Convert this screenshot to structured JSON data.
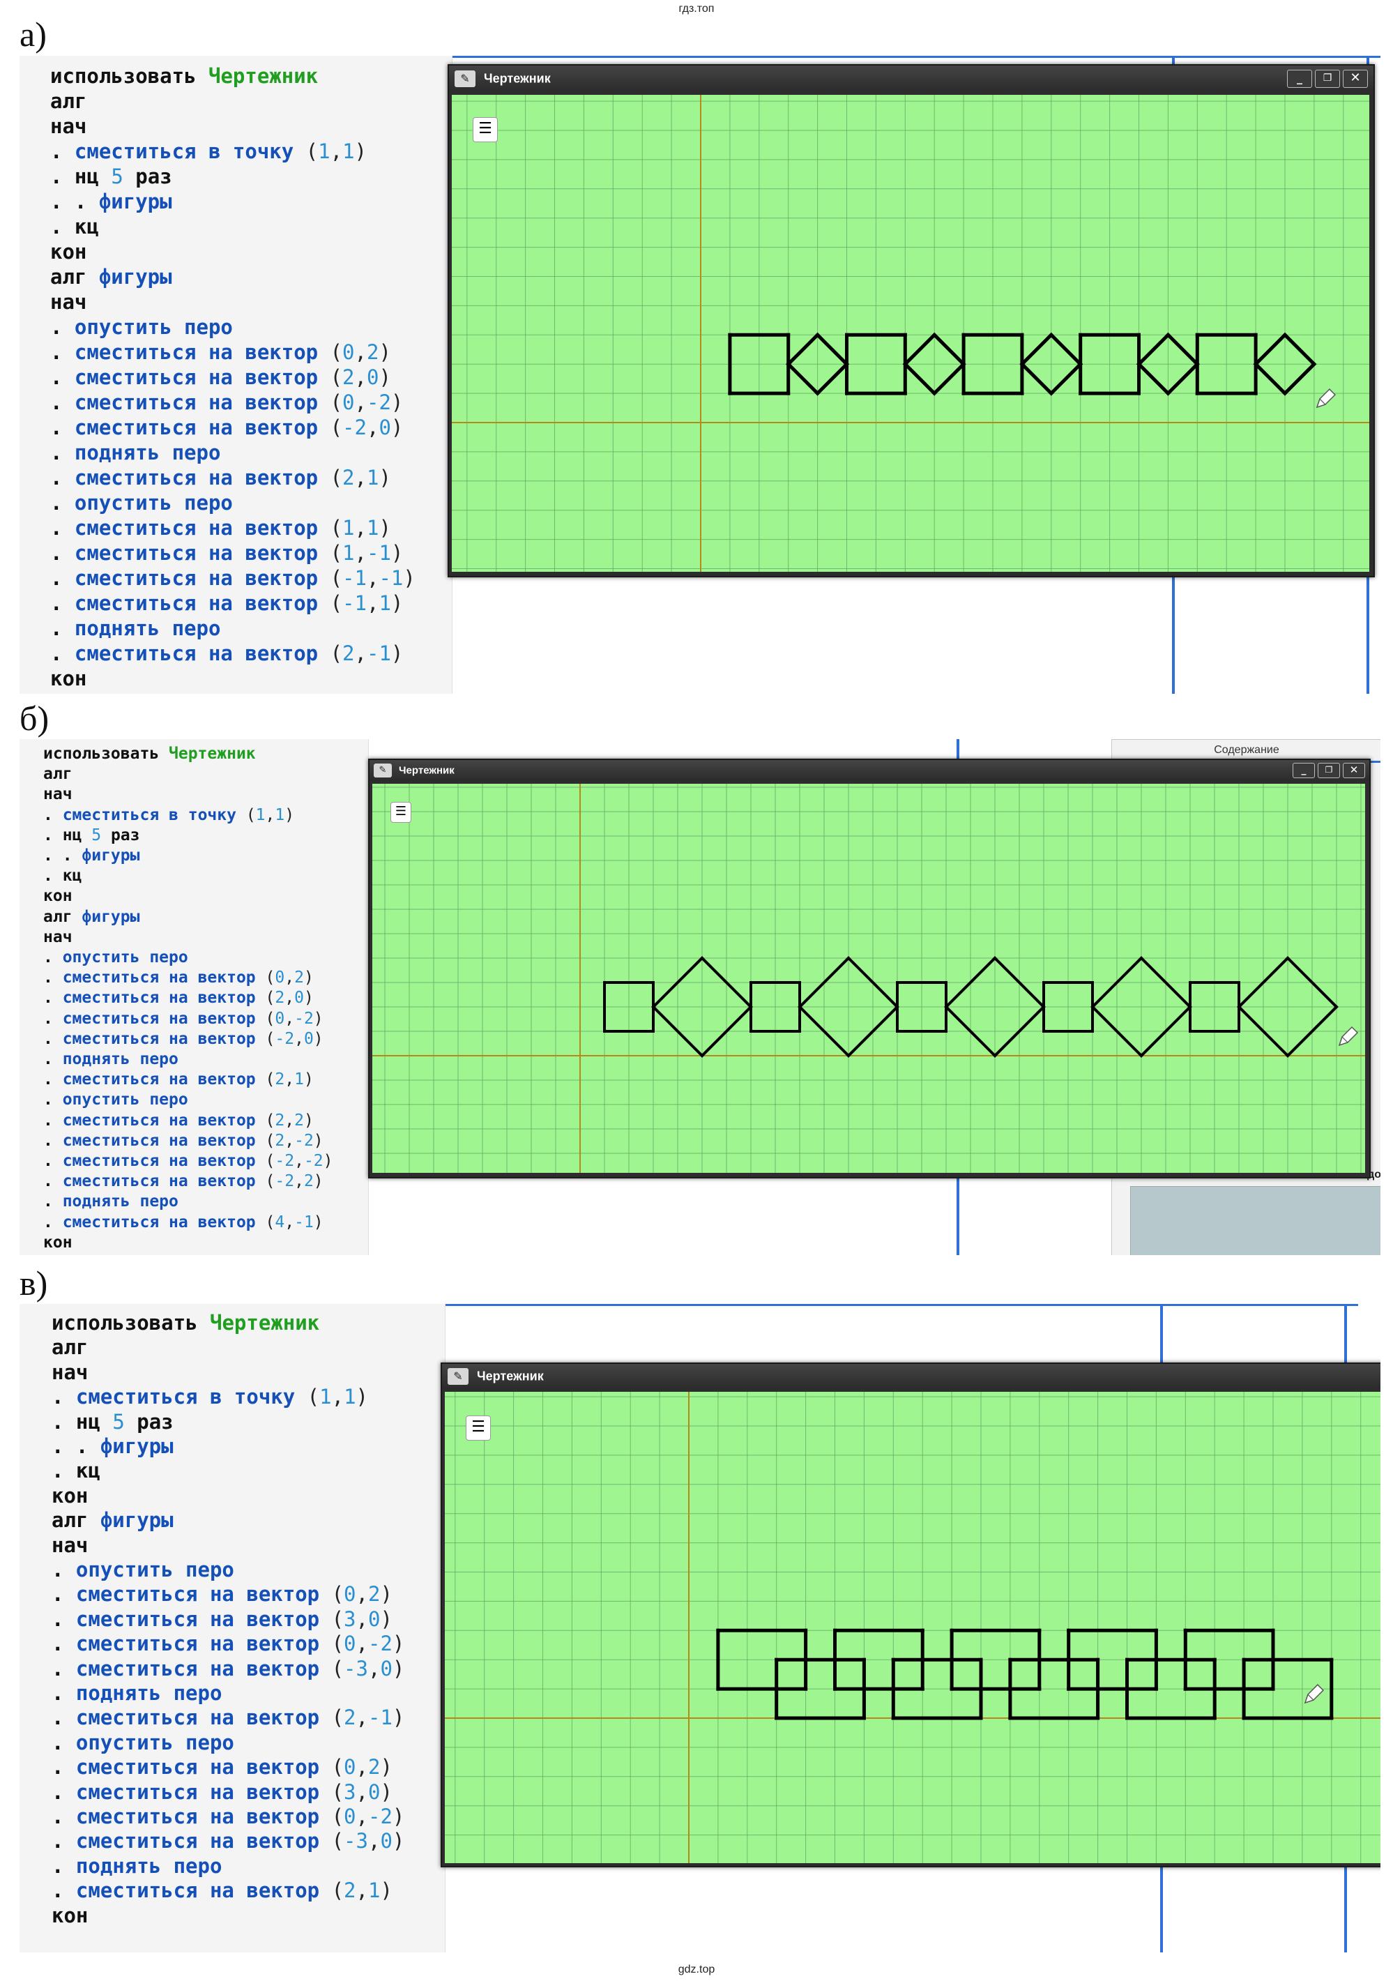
{
  "watermarks": {
    "top": "гдз.топ",
    "bottom": "gdz.top"
  },
  "panels": [
    {
      "label": "а)",
      "window_title": "Чертежник",
      "code": [
        [
          "использовать ",
          "Чертежник"
        ],
        [
          "алг"
        ],
        [
          "нач"
        ],
        [
          ". ",
          "сместиться в точку ",
          "(1,1)"
        ],
        [
          ". ",
          "нц ",
          "5",
          " раз"
        ],
        [
          ". . ",
          "фигуры"
        ],
        [
          ". ",
          "кц"
        ],
        [
          "кон"
        ],
        [
          "алг ",
          "фигуры"
        ],
        [
          "нач"
        ],
        [
          ". ",
          "опустить перо"
        ],
        [
          ". ",
          "сместиться на вектор ",
          "(0,2)"
        ],
        [
          ". ",
          "сместиться на вектор ",
          "(2,0)"
        ],
        [
          ". ",
          "сместиться на вектор ",
          "(0,-2)"
        ],
        [
          ". ",
          "сместиться на вектор ",
          "(-2,0)"
        ],
        [
          ". ",
          "поднять перо"
        ],
        [
          ". ",
          "сместиться на вектор ",
          "(2,1)"
        ],
        [
          ". ",
          "опустить перо"
        ],
        [
          ". ",
          "сместиться на вектор ",
          "(1,1)"
        ],
        [
          ". ",
          "сместиться на вектор ",
          "(1,-1)"
        ],
        [
          ". ",
          "сместиться на вектор ",
          "(-1,-1)"
        ],
        [
          ". ",
          "сместиться на вектор ",
          "(-1,1)"
        ],
        [
          ". ",
          "поднять перо"
        ],
        [
          ". ",
          "сместиться на вектор ",
          "(2,-1)"
        ],
        [
          "кон"
        ]
      ]
    },
    {
      "label": "б)",
      "window_title": "Чертежник",
      "side_title": "Содержание",
      "side_fragment": "водо",
      "code": [
        [
          "использовать ",
          "Чертежник"
        ],
        [
          "алг"
        ],
        [
          "нач"
        ],
        [
          ". ",
          "сместиться в точку ",
          "(1,1)"
        ],
        [
          ". ",
          "нц ",
          "5",
          " раз"
        ],
        [
          ". . ",
          "фигуры"
        ],
        [
          ". ",
          "кц"
        ],
        [
          "кон"
        ],
        [
          "алг ",
          "фигуры"
        ],
        [
          "нач"
        ],
        [
          ". ",
          "опустить перо"
        ],
        [
          ". ",
          "сместиться на вектор ",
          "(0,2)"
        ],
        [
          ". ",
          "сместиться на вектор ",
          "(2,0)"
        ],
        [
          ". ",
          "сместиться на вектор ",
          "(0,-2)"
        ],
        [
          ". ",
          "сместиться на вектор ",
          "(-2,0)"
        ],
        [
          ". ",
          "поднять перо"
        ],
        [
          ". ",
          "сместиться на вектор ",
          "(2,1)"
        ],
        [
          ". ",
          "опустить перо"
        ],
        [
          ". ",
          "сместиться на вектор ",
          "(2,2)"
        ],
        [
          ". ",
          "сместиться на вектор ",
          "(2,-2)"
        ],
        [
          ". ",
          "сместиться на вектор ",
          "(-2,-2)"
        ],
        [
          ". ",
          "сместиться на вектор ",
          "(-2,2)"
        ],
        [
          ". ",
          "поднять перо"
        ],
        [
          ". ",
          "сместиться на вектор ",
          "(4,-1)"
        ],
        [
          "кон"
        ]
      ]
    },
    {
      "label": "в)",
      "window_title": "Чертежник",
      "code": [
        [
          "использовать ",
          "Чертежник"
        ],
        [
          "алг"
        ],
        [
          "нач"
        ],
        [
          ". ",
          "сместиться в точку ",
          "(1,1)"
        ],
        [
          ". ",
          "нц ",
          "5",
          " раз"
        ],
        [
          ". . ",
          "фигуры"
        ],
        [
          ". ",
          "кц"
        ],
        [
          "кон"
        ],
        [
          "алг ",
          "фигуры"
        ],
        [
          "нач"
        ],
        [
          ". ",
          "опустить перо"
        ],
        [
          ". ",
          "сместиться на вектор ",
          "(0,2)"
        ],
        [
          ". ",
          "сместиться на вектор ",
          "(3,0)"
        ],
        [
          ". ",
          "сместиться на вектор ",
          "(0,-2)"
        ],
        [
          ". ",
          "сместиться на вектор ",
          "(-3,0)"
        ],
        [
          ". ",
          "поднять перо"
        ],
        [
          ". ",
          "сместиться на вектор ",
          "(2,-1)"
        ],
        [
          ". ",
          "опустить перо"
        ],
        [
          ". ",
          "сместиться на вектор ",
          "(0,2)"
        ],
        [
          ". ",
          "сместиться на вектор ",
          "(3,0)"
        ],
        [
          ". ",
          "сместиться на вектор ",
          "(0,-2)"
        ],
        [
          ". ",
          "сместиться на вектор ",
          "(-3,0)"
        ],
        [
          ". ",
          "поднять перо"
        ],
        [
          ". ",
          "сместиться на вектор ",
          "(2,1)"
        ],
        [
          "кон"
        ]
      ]
    }
  ],
  "colors": {
    "canvas": "#9ff58f",
    "grid": "#5fa060",
    "axis": "#b58a1a",
    "pen": "#000000",
    "keyword_green": "#1f9e1f",
    "keyword_blue": "#1550b8",
    "number": "#2a8fd0"
  }
}
